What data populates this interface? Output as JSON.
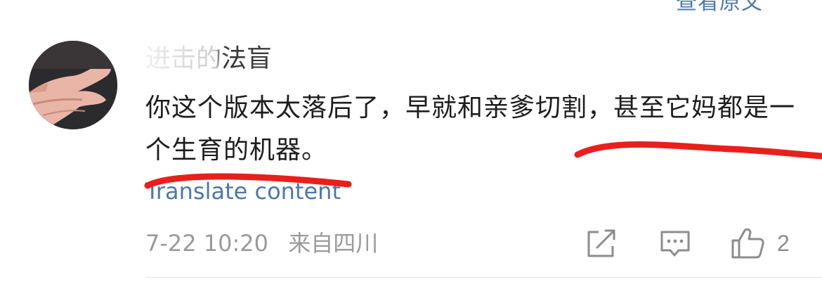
{
  "top_fragment": "查看原文",
  "comment": {
    "username": "进击的法盲",
    "text": "你这个版本太落后了，早就和亲爹切割，甚至它妈都是一个生育的机器。",
    "translate_label": "Translate content",
    "date": "7-22 10:20",
    "location": "来自四川",
    "like_count": "2"
  },
  "icons": {
    "share": "share-icon",
    "reply": "comment-icon",
    "like": "thumbs-up-icon"
  },
  "colors": {
    "link": "#4e78a6",
    "meta": "#9a9a9a",
    "annotation": "#e8201c",
    "text": "#1d1d1d"
  }
}
